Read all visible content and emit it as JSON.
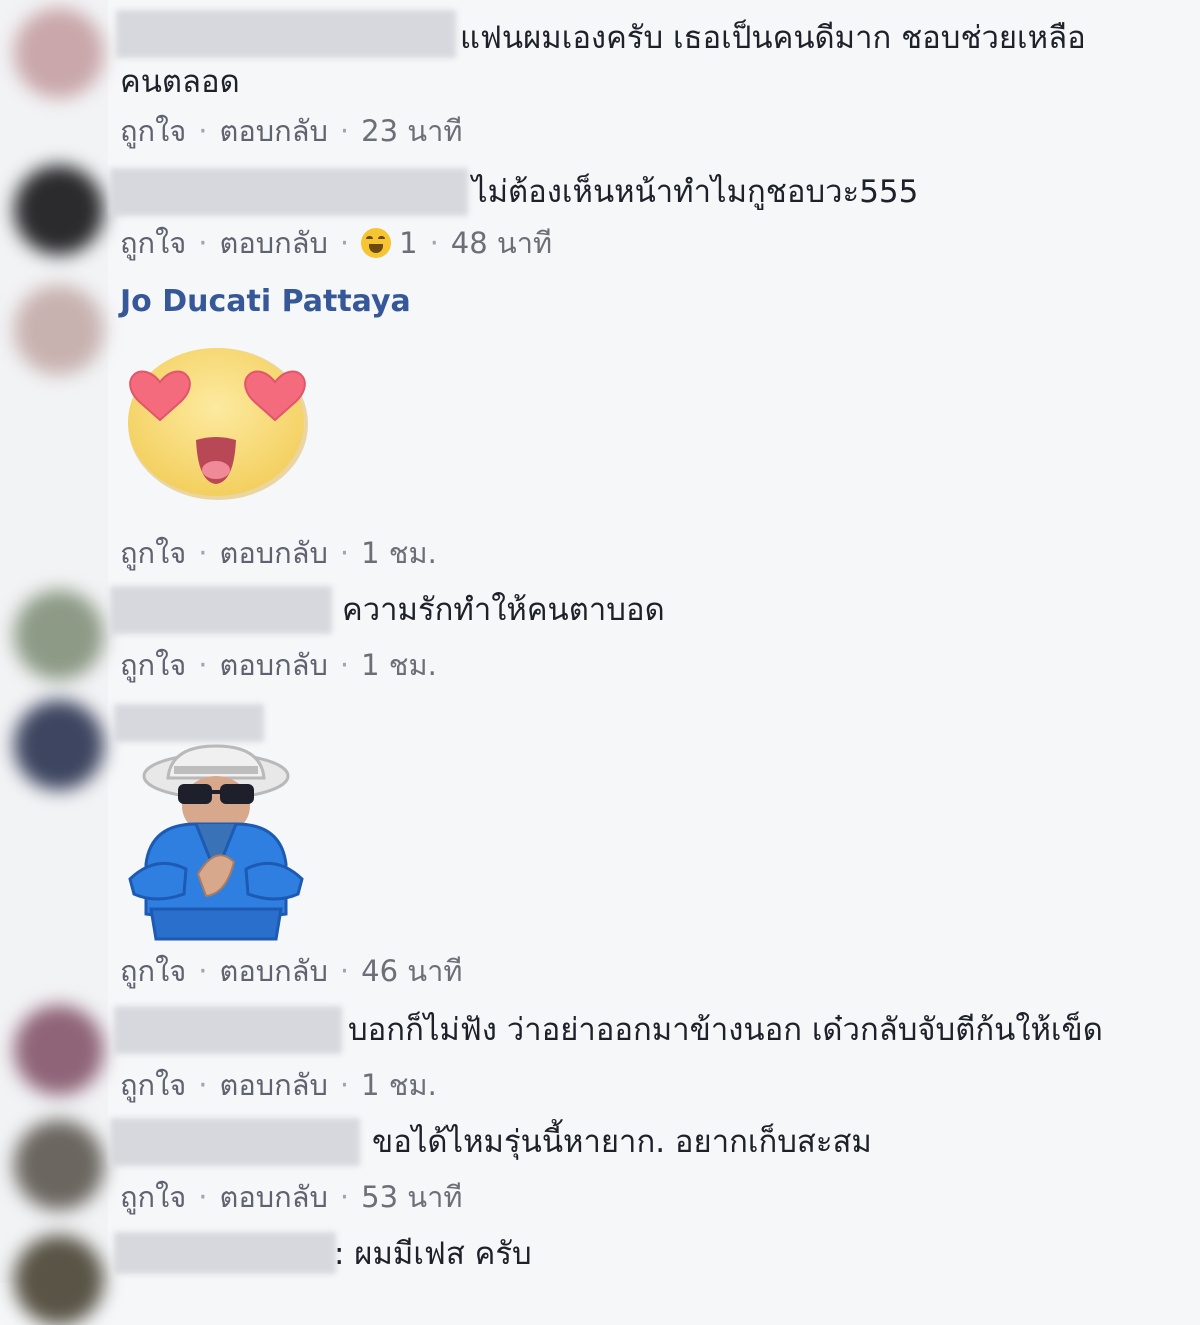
{
  "action_like": "ถูกใจ",
  "action_reply": "ตอบกลับ",
  "comments": [
    {
      "text_line1": "แฟนผมเองครับ เธอเป็นคนดีมาก ชอบช่วยเหลือ",
      "text_line2": "คนตลอด",
      "time": "23 นาที"
    },
    {
      "text": "ไม่ต้องเห็นหน้าทำไมกูชอบวะ555",
      "reaction_count": "1",
      "reaction_icon": "laughing-emoji-icon",
      "time": "48 นาที"
    },
    {
      "author": "Jo Ducati Pattaya",
      "sticker": "heart-eyes-emoji-sticker",
      "time": "1 ชม."
    },
    {
      "text": "ความรักทำให้คนตาบอด",
      "time": "1 ชม."
    },
    {
      "sticker": "old-man-clapping-sticker",
      "time": "46 นาที"
    },
    {
      "text": "บอกก็ไม่ฟัง ว่าอย่าออกมาข้างนอก เด๋วกลับจับตีก้นให้เข็ด",
      "time": "1 ชม."
    },
    {
      "text": "ขอได้ไหมรุ่นนี้หายาก. อยากเก็บสะสม",
      "time": "53 นาที"
    },
    {
      "text": ": ผมมีเฟส ครับ"
    }
  ],
  "colors": {
    "author_link": "#365899",
    "text": "#1d2129",
    "meta": "#6b6f78",
    "background": "#f6f7f9"
  }
}
